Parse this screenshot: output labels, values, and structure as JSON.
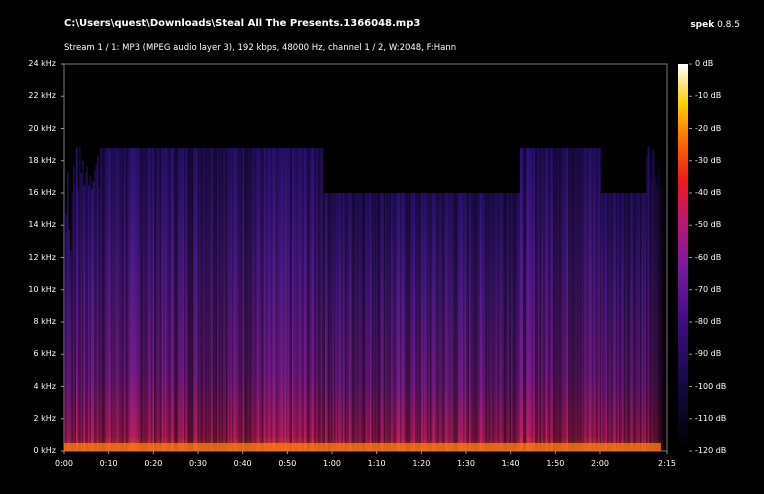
{
  "header": {
    "file_path": "C:\\Users\\quest\\Downloads\\Steal All The Presents.1366048.mp3",
    "app_name": "spek",
    "app_version": "0.8.5",
    "stream_info": "Stream 1 / 1: MP3 (MPEG audio layer 3), 192 kbps, 48000 Hz, channel 1 / 2, W:2048, F:Hann"
  },
  "spectrogram": {
    "freq_axis": [
      "0 kHz",
      "2 kHz",
      "4 kHz",
      "6 kHz",
      "8 kHz",
      "10 kHz",
      "12 kHz",
      "14 kHz",
      "16 kHz",
      "18 kHz",
      "20 kHz",
      "22 kHz",
      "24 kHz"
    ],
    "time_axis": [
      "0:00",
      "0:10",
      "0:20",
      "0:30",
      "0:40",
      "0:50",
      "1:00",
      "1:10",
      "1:20",
      "1:30",
      "1:40",
      "1:50",
      "2:00",
      "2:15"
    ],
    "freq_max_khz": 24,
    "duration_seconds": 135,
    "cutoff_khz": 18.8,
    "lower_cutoff_khz": 16,
    "lower_cutoff_segments_seconds": [
      [
        58,
        95
      ],
      [
        95,
        102
      ],
      [
        120,
        130
      ]
    ]
  },
  "colorbar": {
    "labels": [
      "0 dB",
      "-10 dB",
      "-20 dB",
      "-30 dB",
      "-40 dB",
      "-50 dB",
      "-60 dB",
      "-70 dB",
      "-80 dB",
      "-90 dB",
      "-100 dB",
      "-110 dB",
      "-120 dB"
    ],
    "range_db": [
      -120,
      0
    ]
  }
}
